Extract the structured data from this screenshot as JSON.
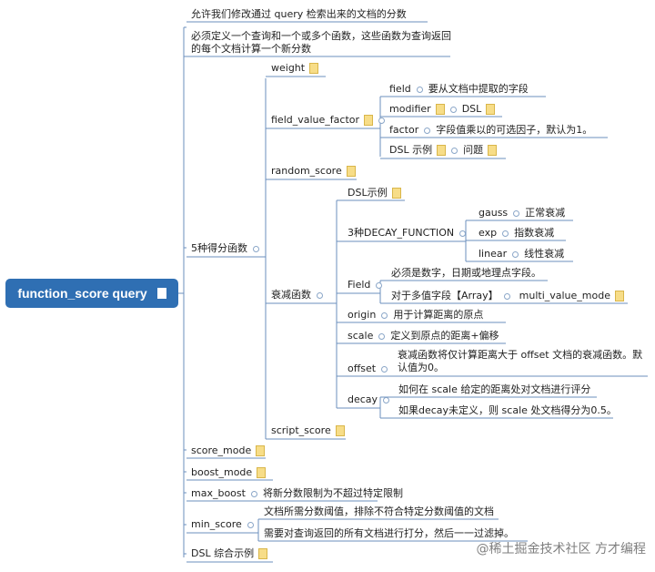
{
  "root": {
    "label": "function_score query"
  },
  "top": {
    "desc1": "允许我们修改通过 query 检索出来的文档的分数",
    "desc2": "必须定义一个查询和一个或多个函数，这些函数为查询返回的每个文档计算一个新分数"
  },
  "five": {
    "label": "5种得分函数",
    "weight": "weight",
    "fvf": {
      "label": "field_value_factor",
      "field": "field",
      "field_desc": "要从文档中提取的字段",
      "modifier": "modifier",
      "modifier_desc": "DSL",
      "factor": "factor",
      "factor_desc": "字段值乘以的可选因子，默认为1。",
      "dsl": "DSL 示例",
      "dsl_desc": "问题"
    },
    "random": "random_score",
    "decay": {
      "label": "衰减函数",
      "dsl_example": "DSL示例",
      "three": "3种DECAY_FUNCTION",
      "gauss": "gauss",
      "gauss_desc": "正常衰减",
      "exp": "exp",
      "exp_desc": "指数衰减",
      "linear": "linear",
      "linear_desc": "线性衰减",
      "field": "Field",
      "field_desc1": "必须是数字，日期或地理点字段。",
      "field_desc2": "对于多值字段【Array】",
      "multi": "multi_value_mode",
      "origin": "origin",
      "origin_desc": "用于计算距离的原点",
      "scale": "scale",
      "scale_desc": "定义到原点的距离+偏移",
      "offset": "offset",
      "offset_desc": "衰减函数将仅计算距离大于 offset 文档的衰减函数。默认值为0。",
      "decayk": "decay",
      "decay_desc1": "如何在 scale 给定的距离处对文档进行评分",
      "decay_desc2": "如果decay未定义，则 scale 处文档得分为0.5。"
    },
    "script": "script_score"
  },
  "score_mode": "score_mode",
  "boost_mode": "boost_mode",
  "max_boost": {
    "label": "max_boost",
    "desc": "将新分数限制为不超过特定限制"
  },
  "min_score": {
    "label": "min_score",
    "desc1": "文档所需分数阈值，排除不符合特定分数阈值的文档",
    "desc2": "需要对查询返回的所有文档进行打分，然后一一过滤掉。"
  },
  "dsl_all": "DSL 综合示例",
  "watermark": "@稀土掘金技术社区  方才编程",
  "colors": {
    "root": "#2f6fb3",
    "line": "#6b8fbd",
    "note": "#f7dd88"
  }
}
